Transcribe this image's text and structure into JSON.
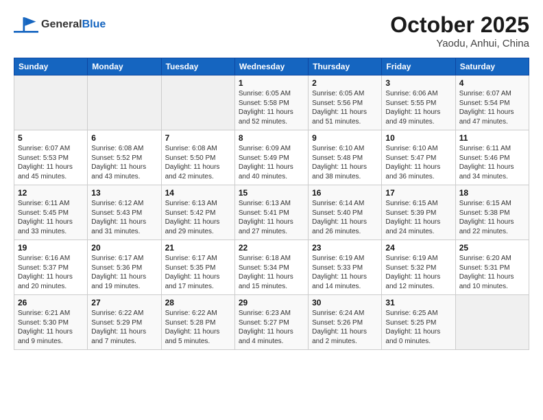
{
  "logo": {
    "line1": "General",
    "line2": "Blue"
  },
  "title": "October 2025",
  "subtitle": "Yaodu, Anhui, China",
  "weekdays": [
    "Sunday",
    "Monday",
    "Tuesday",
    "Wednesday",
    "Thursday",
    "Friday",
    "Saturday"
  ],
  "weeks": [
    [
      {
        "num": "",
        "info": ""
      },
      {
        "num": "",
        "info": ""
      },
      {
        "num": "",
        "info": ""
      },
      {
        "num": "1",
        "info": "Sunrise: 6:05 AM\nSunset: 5:58 PM\nDaylight: 11 hours\nand 52 minutes."
      },
      {
        "num": "2",
        "info": "Sunrise: 6:05 AM\nSunset: 5:56 PM\nDaylight: 11 hours\nand 51 minutes."
      },
      {
        "num": "3",
        "info": "Sunrise: 6:06 AM\nSunset: 5:55 PM\nDaylight: 11 hours\nand 49 minutes."
      },
      {
        "num": "4",
        "info": "Sunrise: 6:07 AM\nSunset: 5:54 PM\nDaylight: 11 hours\nand 47 minutes."
      }
    ],
    [
      {
        "num": "5",
        "info": "Sunrise: 6:07 AM\nSunset: 5:53 PM\nDaylight: 11 hours\nand 45 minutes."
      },
      {
        "num": "6",
        "info": "Sunrise: 6:08 AM\nSunset: 5:52 PM\nDaylight: 11 hours\nand 43 minutes."
      },
      {
        "num": "7",
        "info": "Sunrise: 6:08 AM\nSunset: 5:50 PM\nDaylight: 11 hours\nand 42 minutes."
      },
      {
        "num": "8",
        "info": "Sunrise: 6:09 AM\nSunset: 5:49 PM\nDaylight: 11 hours\nand 40 minutes."
      },
      {
        "num": "9",
        "info": "Sunrise: 6:10 AM\nSunset: 5:48 PM\nDaylight: 11 hours\nand 38 minutes."
      },
      {
        "num": "10",
        "info": "Sunrise: 6:10 AM\nSunset: 5:47 PM\nDaylight: 11 hours\nand 36 minutes."
      },
      {
        "num": "11",
        "info": "Sunrise: 6:11 AM\nSunset: 5:46 PM\nDaylight: 11 hours\nand 34 minutes."
      }
    ],
    [
      {
        "num": "12",
        "info": "Sunrise: 6:11 AM\nSunset: 5:45 PM\nDaylight: 11 hours\nand 33 minutes."
      },
      {
        "num": "13",
        "info": "Sunrise: 6:12 AM\nSunset: 5:43 PM\nDaylight: 11 hours\nand 31 minutes."
      },
      {
        "num": "14",
        "info": "Sunrise: 6:13 AM\nSunset: 5:42 PM\nDaylight: 11 hours\nand 29 minutes."
      },
      {
        "num": "15",
        "info": "Sunrise: 6:13 AM\nSunset: 5:41 PM\nDaylight: 11 hours\nand 27 minutes."
      },
      {
        "num": "16",
        "info": "Sunrise: 6:14 AM\nSunset: 5:40 PM\nDaylight: 11 hours\nand 26 minutes."
      },
      {
        "num": "17",
        "info": "Sunrise: 6:15 AM\nSunset: 5:39 PM\nDaylight: 11 hours\nand 24 minutes."
      },
      {
        "num": "18",
        "info": "Sunrise: 6:15 AM\nSunset: 5:38 PM\nDaylight: 11 hours\nand 22 minutes."
      }
    ],
    [
      {
        "num": "19",
        "info": "Sunrise: 6:16 AM\nSunset: 5:37 PM\nDaylight: 11 hours\nand 20 minutes."
      },
      {
        "num": "20",
        "info": "Sunrise: 6:17 AM\nSunset: 5:36 PM\nDaylight: 11 hours\nand 19 minutes."
      },
      {
        "num": "21",
        "info": "Sunrise: 6:17 AM\nSunset: 5:35 PM\nDaylight: 11 hours\nand 17 minutes."
      },
      {
        "num": "22",
        "info": "Sunrise: 6:18 AM\nSunset: 5:34 PM\nDaylight: 11 hours\nand 15 minutes."
      },
      {
        "num": "23",
        "info": "Sunrise: 6:19 AM\nSunset: 5:33 PM\nDaylight: 11 hours\nand 14 minutes."
      },
      {
        "num": "24",
        "info": "Sunrise: 6:19 AM\nSunset: 5:32 PM\nDaylight: 11 hours\nand 12 minutes."
      },
      {
        "num": "25",
        "info": "Sunrise: 6:20 AM\nSunset: 5:31 PM\nDaylight: 11 hours\nand 10 minutes."
      }
    ],
    [
      {
        "num": "26",
        "info": "Sunrise: 6:21 AM\nSunset: 5:30 PM\nDaylight: 11 hours\nand 9 minutes."
      },
      {
        "num": "27",
        "info": "Sunrise: 6:22 AM\nSunset: 5:29 PM\nDaylight: 11 hours\nand 7 minutes."
      },
      {
        "num": "28",
        "info": "Sunrise: 6:22 AM\nSunset: 5:28 PM\nDaylight: 11 hours\nand 5 minutes."
      },
      {
        "num": "29",
        "info": "Sunrise: 6:23 AM\nSunset: 5:27 PM\nDaylight: 11 hours\nand 4 minutes."
      },
      {
        "num": "30",
        "info": "Sunrise: 6:24 AM\nSunset: 5:26 PM\nDaylight: 11 hours\nand 2 minutes."
      },
      {
        "num": "31",
        "info": "Sunrise: 6:25 AM\nSunset: 5:25 PM\nDaylight: 11 hours\nand 0 minutes."
      },
      {
        "num": "",
        "info": ""
      }
    ]
  ]
}
